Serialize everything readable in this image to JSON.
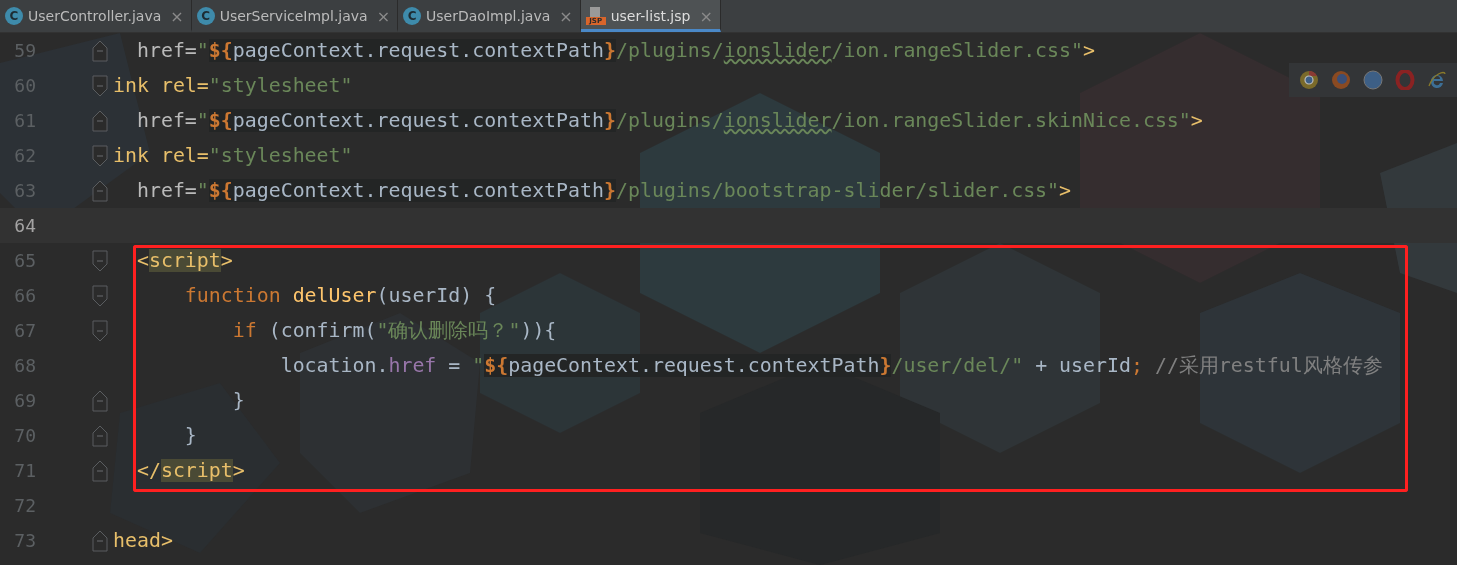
{
  "tabs": [
    {
      "label": "UserController.java",
      "kind": "class",
      "icon_text": "C",
      "close": "×",
      "selected": false
    },
    {
      "label": "UserServiceImpl.java",
      "kind": "class",
      "icon_text": "C",
      "close": "×",
      "selected": false
    },
    {
      "label": "UserDaoImpl.java",
      "kind": "class",
      "icon_text": "C",
      "close": "×",
      "selected": false
    },
    {
      "label": "user-list.jsp",
      "kind": "jsp",
      "icon_text": "JSP",
      "close": "×",
      "selected": true
    }
  ],
  "browser_icons": [
    {
      "kind": "chrome"
    },
    {
      "kind": "firefox"
    },
    {
      "kind": "safari"
    },
    {
      "kind": "opera"
    },
    {
      "kind": "ie"
    }
  ],
  "editor": {
    "lines": [
      {
        "number": "59",
        "fold": {
          "kind": "end"
        },
        "current": false,
        "highlighted": false,
        "tokens": [
          {
            "text": "  href=",
            "kind": "attr"
          },
          {
            "text": "\"",
            "kind": "str"
          },
          {
            "text": "${",
            "kind": "el"
          },
          {
            "text": "pageContext.request.contextPath",
            "kind": "elbody"
          },
          {
            "text": "}",
            "kind": "el"
          },
          {
            "text": "/plugins/",
            "kind": "str"
          },
          {
            "text": "ionslider",
            "kind": "strsq"
          },
          {
            "text": "/ion.rangeSlider.css\"",
            "kind": "str"
          },
          {
            "text": ">",
            "kind": "tag"
          }
        ]
      },
      {
        "number": "60",
        "fold": {
          "kind": "start"
        },
        "current": false,
        "highlighted": false,
        "tokens": [
          {
            "text": "ink rel=",
            "kind": "tag"
          },
          {
            "text": "\"stylesheet\"",
            "kind": "str"
          }
        ]
      },
      {
        "number": "61",
        "fold": {
          "kind": "end"
        },
        "current": false,
        "highlighted": false,
        "tokens": [
          {
            "text": "  href=",
            "kind": "attr"
          },
          {
            "text": "\"",
            "kind": "str"
          },
          {
            "text": "${",
            "kind": "el"
          },
          {
            "text": "pageContext.request.contextPath",
            "kind": "elbody"
          },
          {
            "text": "}",
            "kind": "el"
          },
          {
            "text": "/plugins/",
            "kind": "str"
          },
          {
            "text": "ionslider",
            "kind": "strsq"
          },
          {
            "text": "/ion.rangeSlider.skinNice.css\"",
            "kind": "str"
          },
          {
            "text": ">",
            "kind": "tag"
          }
        ]
      },
      {
        "number": "62",
        "fold": {
          "kind": "start"
        },
        "current": false,
        "highlighted": false,
        "tokens": [
          {
            "text": "ink rel=",
            "kind": "tag"
          },
          {
            "text": "\"stylesheet\"",
            "kind": "str"
          }
        ]
      },
      {
        "number": "63",
        "fold": {
          "kind": "end"
        },
        "current": false,
        "highlighted": false,
        "tokens": [
          {
            "text": "  href=",
            "kind": "attr"
          },
          {
            "text": "\"",
            "kind": "str"
          },
          {
            "text": "${",
            "kind": "el"
          },
          {
            "text": "pageContext.request.contextPath",
            "kind": "elbody"
          },
          {
            "text": "}",
            "kind": "el"
          },
          {
            "text": "/plugins/bootstrap-slider/slider.css\"",
            "kind": "str"
          },
          {
            "text": ">",
            "kind": "tag"
          }
        ]
      },
      {
        "number": "64",
        "current": true,
        "highlighted": false
      },
      {
        "number": "65",
        "fold": {
          "kind": "start"
        },
        "current": false,
        "highlighted": true,
        "tokens": [
          {
            "text": "  <",
            "kind": "tag"
          },
          {
            "text": "script",
            "kind": "tagmatch"
          },
          {
            "text": ">",
            "kind": "tag"
          }
        ]
      },
      {
        "number": "66",
        "fold": {
          "kind": "start"
        },
        "current": false,
        "highlighted": true,
        "tokens": [
          {
            "text": "      function ",
            "kind": "keyword"
          },
          {
            "text": "delUser",
            "kind": "fn"
          },
          {
            "text": "(userId) {",
            "kind": "plain"
          }
        ]
      },
      {
        "number": "67",
        "fold": {
          "kind": "start"
        },
        "current": false,
        "highlighted": true,
        "tokens": [
          {
            "text": "          if ",
            "kind": "keyword"
          },
          {
            "text": "(confirm(",
            "kind": "plain"
          },
          {
            "text": "\"确认删除吗？\"",
            "kind": "str"
          },
          {
            "text": ")){",
            "kind": "plain"
          }
        ]
      },
      {
        "number": "68",
        "current": false,
        "highlighted": true,
        "tokens": [
          {
            "text": "              location.",
            "kind": "plain"
          },
          {
            "text": "href",
            "kind": "prop"
          },
          {
            "text": " = ",
            "kind": "plain"
          },
          {
            "text": "\"",
            "kind": "str"
          },
          {
            "text": "${",
            "kind": "el"
          },
          {
            "text": "pageContext.request.contextPath",
            "kind": "elbody"
          },
          {
            "text": "}",
            "kind": "el"
          },
          {
            "text": "/user/del/\"",
            "kind": "str"
          },
          {
            "text": " + userId",
            "kind": "plain"
          },
          {
            "text": "; ",
            "kind": "keyword"
          },
          {
            "text": "//采用restful风格传参",
            "kind": "comment"
          }
        ]
      },
      {
        "number": "69",
        "fold": {
          "kind": "end"
        },
        "current": false,
        "highlighted": true,
        "tokens": [
          {
            "text": "          }",
            "kind": "plain"
          }
        ]
      },
      {
        "number": "70",
        "fold": {
          "kind": "end"
        },
        "current": false,
        "highlighted": true,
        "tokens": [
          {
            "text": "      }",
            "kind": "plain"
          }
        ]
      },
      {
        "number": "71",
        "fold": {
          "kind": "end"
        },
        "current": false,
        "highlighted": true,
        "tokens": [
          {
            "text": "  </",
            "kind": "tag"
          },
          {
            "text": "script",
            "kind": "tagmatch"
          },
          {
            "text": ">",
            "kind": "tag"
          }
        ]
      },
      {
        "number": "72",
        "current": false,
        "highlighted": false
      },
      {
        "number": "73",
        "fold": {
          "kind": "end"
        },
        "current": false,
        "highlighted": false,
        "tokens": [
          {
            "text": "head>",
            "kind": "tag"
          }
        ]
      }
    ]
  }
}
